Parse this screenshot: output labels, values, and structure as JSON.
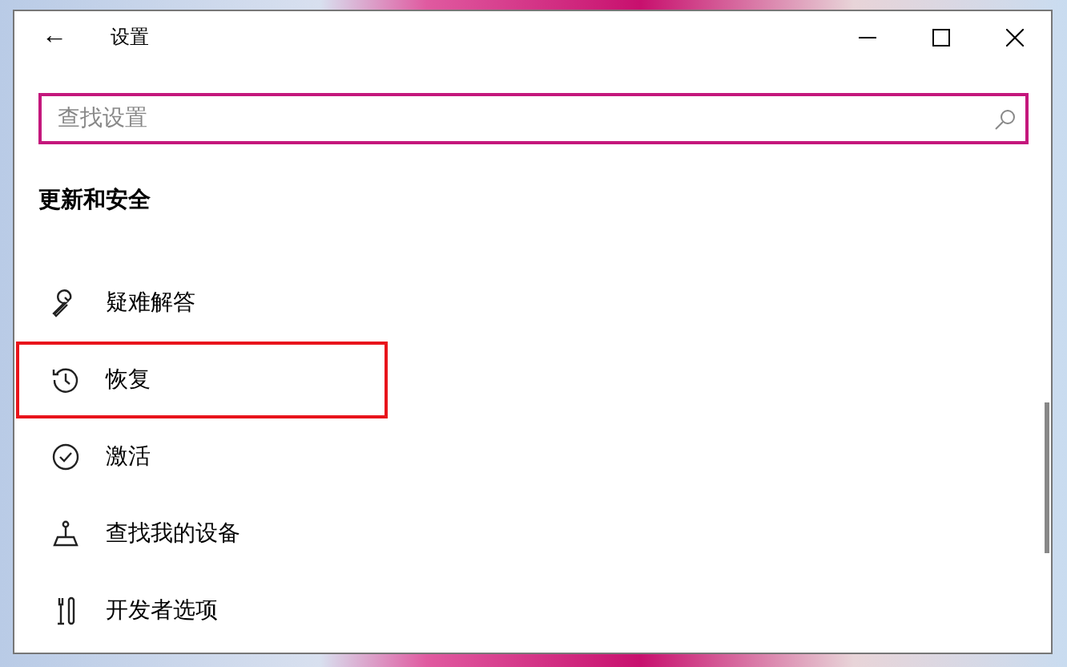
{
  "window": {
    "title": "设置",
    "back": "←"
  },
  "search": {
    "placeholder": "查找设置"
  },
  "section_title": "更新和安全",
  "nav_items": [
    {
      "label": "疑难解答",
      "highlighted": false
    },
    {
      "label": "恢复",
      "highlighted": true
    },
    {
      "label": "激活",
      "highlighted": false
    },
    {
      "label": "查找我的设备",
      "highlighted": false
    },
    {
      "label": "开发者选项",
      "highlighted": false
    }
  ]
}
